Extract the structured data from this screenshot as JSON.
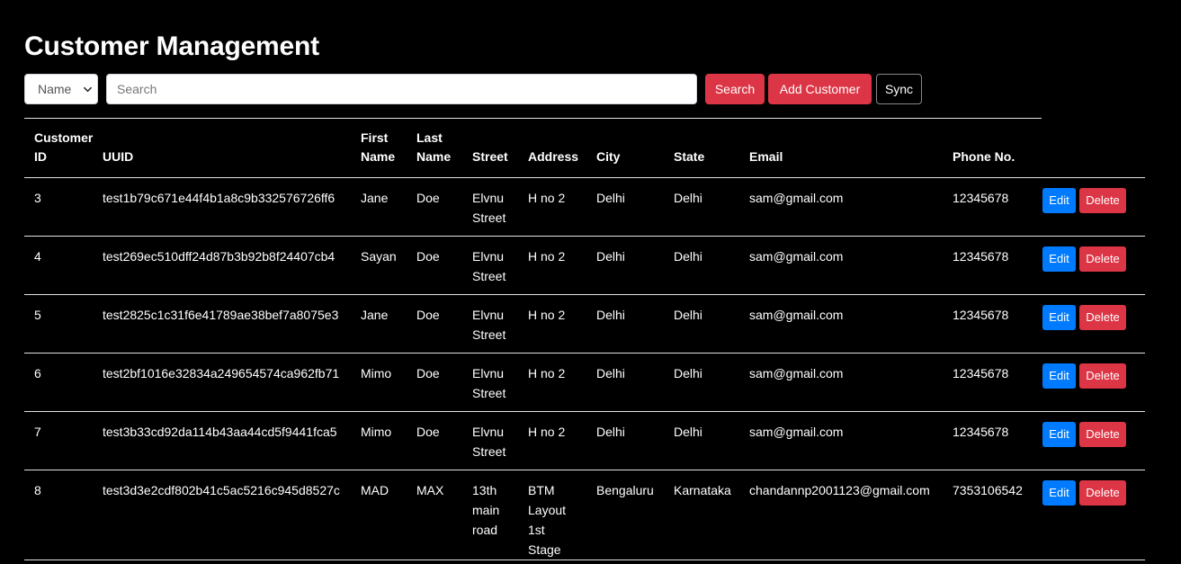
{
  "page_title": "Customer Management",
  "toolbar": {
    "filter_selected": "Name",
    "search_placeholder": "Search",
    "search_value": "",
    "search_label": "Search",
    "add_label": "Add Customer",
    "sync_label": "Sync"
  },
  "colors": {
    "background": "#000000",
    "danger": "#dc3545",
    "primary": "#007bff"
  },
  "table": {
    "headers": {
      "customer_id": [
        "Customer",
        "ID"
      ],
      "uuid": "UUID",
      "first_name": [
        "First",
        "Name"
      ],
      "last_name": [
        "Last",
        "Name"
      ],
      "street": "Street",
      "address": "Address",
      "city": "City",
      "state": "State",
      "email": "Email",
      "phone": "Phone No."
    },
    "edit_label": "Edit",
    "delete_label": "Delete",
    "rows": [
      {
        "id": "3",
        "uuid": "test1b79c671e44f4b1a8c9b332576726ff6",
        "first": "Jane",
        "last": "Doe",
        "street": [
          "Elvnu",
          "Street"
        ],
        "address": [
          "H no 2"
        ],
        "city": "Delhi",
        "state": "Delhi",
        "email": "sam@gmail.com",
        "phone": "12345678"
      },
      {
        "id": "4",
        "uuid": "test269ec510dff24d87b3b92b8f24407cb4",
        "first": "Sayan",
        "last": "Doe",
        "street": [
          "Elvnu",
          "Street"
        ],
        "address": [
          "H no 2"
        ],
        "city": "Delhi",
        "state": "Delhi",
        "email": "sam@gmail.com",
        "phone": "12345678"
      },
      {
        "id": "5",
        "uuid": "test2825c1c31f6e41789ae38bef7a8075e3",
        "first": "Jane",
        "last": "Doe",
        "street": [
          "Elvnu",
          "Street"
        ],
        "address": [
          "H no 2"
        ],
        "city": "Delhi",
        "state": "Delhi",
        "email": "sam@gmail.com",
        "phone": "12345678"
      },
      {
        "id": "6",
        "uuid": "test2bf1016e32834a249654574ca962fb71",
        "first": "Mimo",
        "last": "Doe",
        "street": [
          "Elvnu",
          "Street"
        ],
        "address": [
          "H no 2"
        ],
        "city": "Delhi",
        "state": "Delhi",
        "email": "sam@gmail.com",
        "phone": "12345678"
      },
      {
        "id": "7",
        "uuid": "test3b33cd92da114b43aa44cd5f9441fca5",
        "first": "Mimo",
        "last": "Doe",
        "street": [
          "Elvnu",
          "Street"
        ],
        "address": [
          "H no 2"
        ],
        "city": "Delhi",
        "state": "Delhi",
        "email": "sam@gmail.com",
        "phone": "12345678"
      },
      {
        "id": "8",
        "uuid": "test3d3e2cdf802b41c5ac5216c945d8527c",
        "first": "MAD",
        "last": "MAX",
        "street": [
          "13th",
          "main",
          "road"
        ],
        "address": [
          "BTM",
          "Layout",
          "1st",
          "Stage"
        ],
        "city": "Bengaluru",
        "state": "Karnataka",
        "email": "chandannp2001123@gmail.com",
        "phone": "7353106542"
      }
    ]
  }
}
